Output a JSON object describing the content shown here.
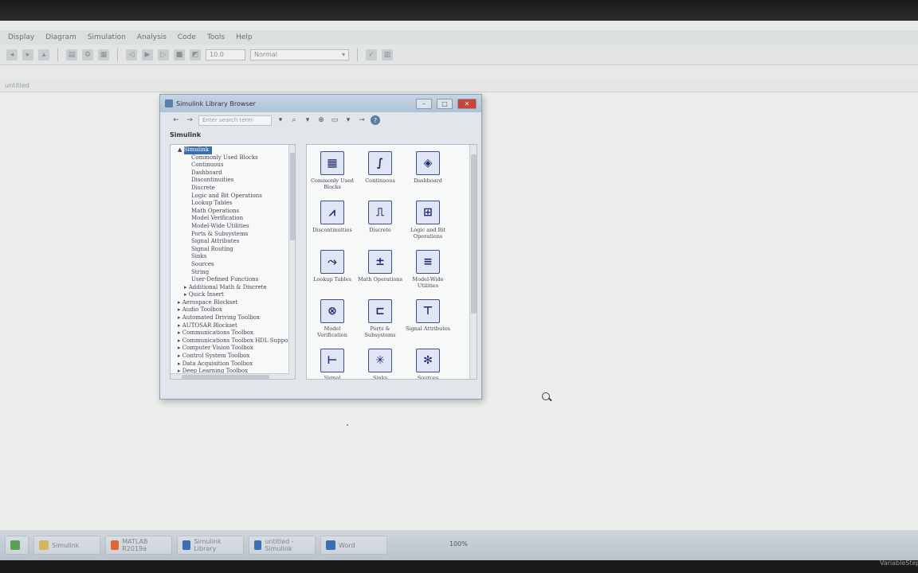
{
  "menubar": {
    "items": [
      "Display",
      "Diagram",
      "Simulation",
      "Analysis",
      "Code",
      "Tools",
      "Help"
    ]
  },
  "toolbar": {
    "stop_time": "10.0",
    "sim_mode": "Normal"
  },
  "pathbar": {
    "label": "untitled"
  },
  "library_browser": {
    "title": "Simulink Library Browser",
    "search_placeholder": "Enter search term",
    "section_title": "Simulink",
    "tree": [
      {
        "label": "Simulink",
        "indent": 0,
        "prefix": "▲",
        "selected": true
      },
      {
        "label": "Commonly Used Blocks",
        "indent": 1,
        "prefix": ""
      },
      {
        "label": "Continuous",
        "indent": 1,
        "prefix": ""
      },
      {
        "label": "Dashboard",
        "indent": 1,
        "prefix": ""
      },
      {
        "label": "Discontinuities",
        "indent": 1,
        "prefix": ""
      },
      {
        "label": "Discrete",
        "indent": 1,
        "prefix": ""
      },
      {
        "label": "Logic and Bit Operations",
        "indent": 1,
        "prefix": ""
      },
      {
        "label": "Lookup Tables",
        "indent": 1,
        "prefix": ""
      },
      {
        "label": "Math Operations",
        "indent": 1,
        "prefix": ""
      },
      {
        "label": "Model Verification",
        "indent": 1,
        "prefix": ""
      },
      {
        "label": "Model-Wide Utilities",
        "indent": 1,
        "prefix": ""
      },
      {
        "label": "Ports & Subsystems",
        "indent": 1,
        "prefix": ""
      },
      {
        "label": "Signal Attributes",
        "indent": 1,
        "prefix": ""
      },
      {
        "label": "Signal Routing",
        "indent": 1,
        "prefix": ""
      },
      {
        "label": "Sinks",
        "indent": 1,
        "prefix": ""
      },
      {
        "label": "Sources",
        "indent": 1,
        "prefix": ""
      },
      {
        "label": "String",
        "indent": 1,
        "prefix": ""
      },
      {
        "label": "User-Defined Functions",
        "indent": 1,
        "prefix": ""
      },
      {
        "label": "Additional Math & Discrete",
        "indent": 1,
        "prefix": "▸"
      },
      {
        "label": "Quick Insert",
        "indent": 1,
        "prefix": "▸"
      },
      {
        "label": "Aerospace Blockset",
        "indent": 0,
        "prefix": "▸"
      },
      {
        "label": "Audio Toolbox",
        "indent": 0,
        "prefix": "▸"
      },
      {
        "label": "Automated Driving Toolbox",
        "indent": 0,
        "prefix": "▸"
      },
      {
        "label": "AUTOSAR Blockset",
        "indent": 0,
        "prefix": "▸"
      },
      {
        "label": "Communications Toolbox",
        "indent": 0,
        "prefix": "▸"
      },
      {
        "label": "Communications Toolbox HDL Support",
        "indent": 0,
        "prefix": "▸"
      },
      {
        "label": "Computer Vision Toolbox",
        "indent": 0,
        "prefix": "▸"
      },
      {
        "label": "Control System Toolbox",
        "indent": 0,
        "prefix": "▸"
      },
      {
        "label": "Data Acquisition Toolbox",
        "indent": 0,
        "prefix": "▸"
      },
      {
        "label": "Deep Learning Toolbox",
        "indent": 0,
        "prefix": "▸"
      }
    ],
    "blocks": [
      {
        "label": "Commonly Used Blocks",
        "glyph": "▦"
      },
      {
        "label": "Continuous",
        "glyph": "∫"
      },
      {
        "label": "Dashboard",
        "glyph": "◈"
      },
      {
        "label": "Discontinuities",
        "glyph": "⩘"
      },
      {
        "label": "Discrete",
        "glyph": "⎍"
      },
      {
        "label": "Logic and Bit Operations",
        "glyph": "⊞"
      },
      {
        "label": "Lookup Tables",
        "glyph": "⤳"
      },
      {
        "label": "Math Operations",
        "glyph": "±"
      },
      {
        "label": "Model-Wide Utilities",
        "glyph": "≡"
      },
      {
        "label": "Model Verification",
        "glyph": "⊗"
      },
      {
        "label": "Ports & Subsystems",
        "glyph": "⊏"
      },
      {
        "label": "Signal Attributes",
        "glyph": "⊤"
      },
      {
        "label": "Signal",
        "glyph": "⊢"
      },
      {
        "label": "Sinks",
        "glyph": "✳"
      },
      {
        "label": "Sources",
        "glyph": "✻"
      }
    ]
  },
  "status": {
    "zoom": "100%",
    "solver": "VariableStep"
  },
  "taskbar": {
    "items": [
      {
        "label": "",
        "color": "#5aa05a"
      },
      {
        "label": "Simulink",
        "color": "#d6b45c"
      },
      {
        "label": "MATLAB R2019a",
        "color": "#e0663a"
      },
      {
        "label": "Simulink Library",
        "color": "#3a6fb5"
      },
      {
        "label": "untitled - Simulink",
        "color": "#3a6fb5"
      },
      {
        "label": "Word",
        "color": "#3a6fb5"
      }
    ]
  },
  "colors": {
    "accent": "#3c6fb2",
    "close": "#c9443a"
  }
}
